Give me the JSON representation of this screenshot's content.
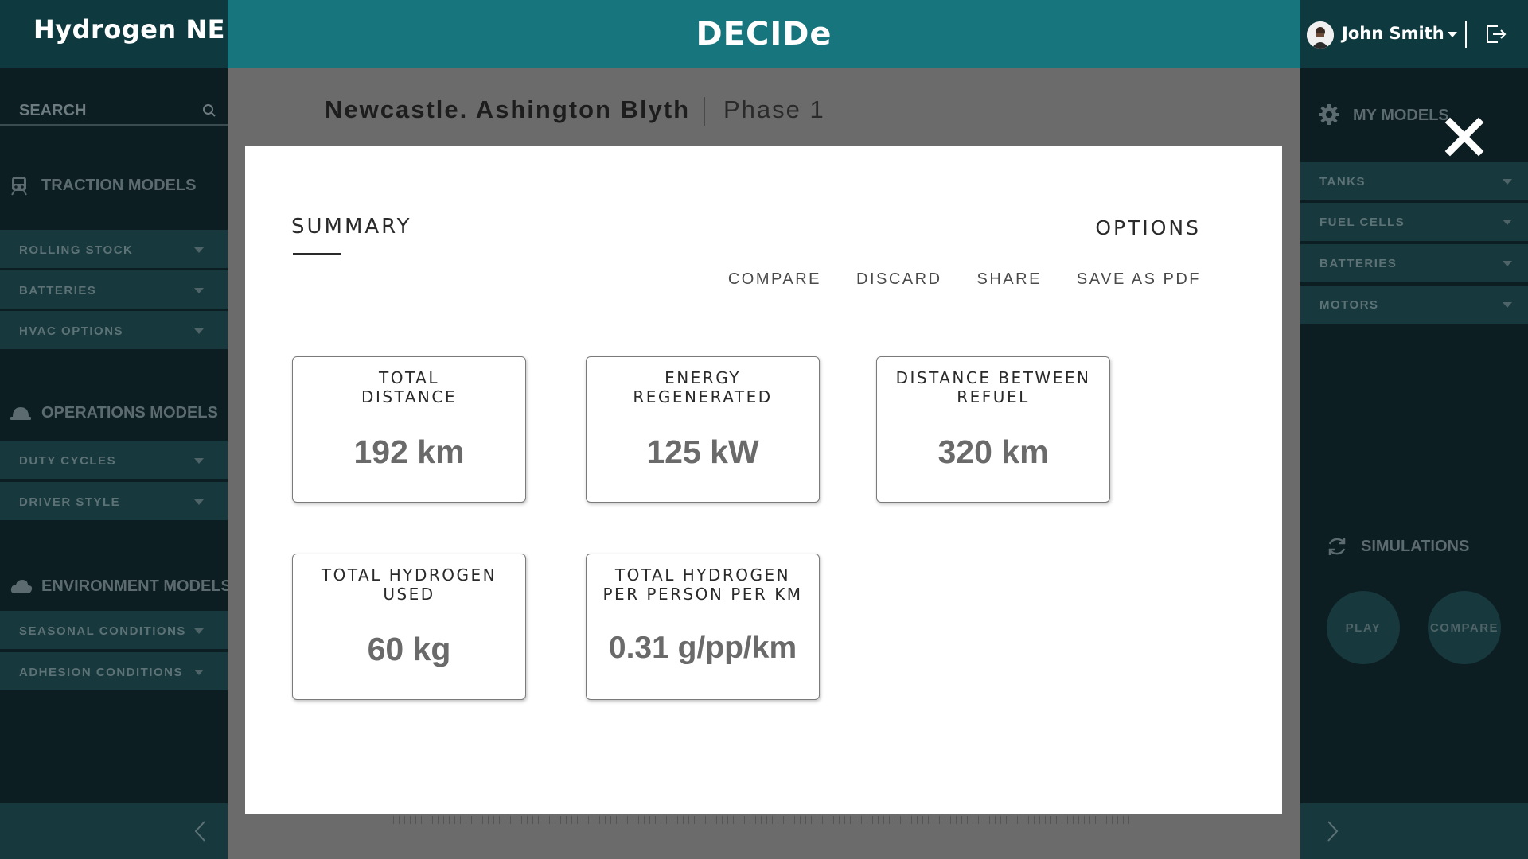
{
  "header": {
    "brand": "Hydrogen NE",
    "app_title": "DECIDe",
    "user_name": "John Smith"
  },
  "left_sidebar": {
    "search_label": "SEARCH",
    "sections": [
      {
        "title": "TRACTION MODELS",
        "icon": "train-icon",
        "items": [
          "ROLLING STOCK",
          "BATTERIES",
          "HVAC OPTIONS"
        ]
      },
      {
        "title": "OPERATIONS MODELS",
        "icon": "hard-hat-icon",
        "items": [
          "DUTY CYCLES",
          "DRIVER STYLE"
        ]
      },
      {
        "title": "ENVIRONMENT MODELS",
        "icon": "cloud-icon",
        "items": [
          "SEASONAL CONDITIONS",
          "ADHESION CONDITIONS"
        ]
      }
    ]
  },
  "main": {
    "project_title": "Newcastle. Ashington Blyth",
    "phase": "Phase 1"
  },
  "right_sidebar": {
    "my_models_label": "MY MODELS",
    "items": [
      "TANKS",
      "FUEL CELLS",
      "BATTERIES",
      "MOTORS"
    ],
    "simulations_label": "SIMULATIONS",
    "play_label": "PLAY",
    "compare_label": "COMPARE"
  },
  "modal": {
    "summary_label": "SUMMARY",
    "options_label": "OPTIONS",
    "actions": [
      "COMPARE",
      "DISCARD",
      "SHARE",
      "SAVE AS PDF"
    ],
    "cards": [
      {
        "label_line1": "TOTAL",
        "label_line2": "DISTANCE",
        "value": "192 km"
      },
      {
        "label_line1": "ENERGY",
        "label_line2": "REGENERATED",
        "value": "125 kW"
      },
      {
        "label_line1": "DISTANCE BETWEEN",
        "label_line2": "REFUEL",
        "value": "320 km"
      },
      {
        "label_line1": "TOTAL HYDROGEN",
        "label_line2": "USED",
        "value": "60 kg"
      },
      {
        "label_line1": "TOTAL HYDROGEN",
        "label_line2": "PER PERSON PER KM",
        "value": "0.31 g/pp/km"
      }
    ]
  },
  "colors": {
    "header_teal": "#17757d",
    "sidebar_dark": "#0c1e22",
    "sidebar_item": "#17383d"
  }
}
